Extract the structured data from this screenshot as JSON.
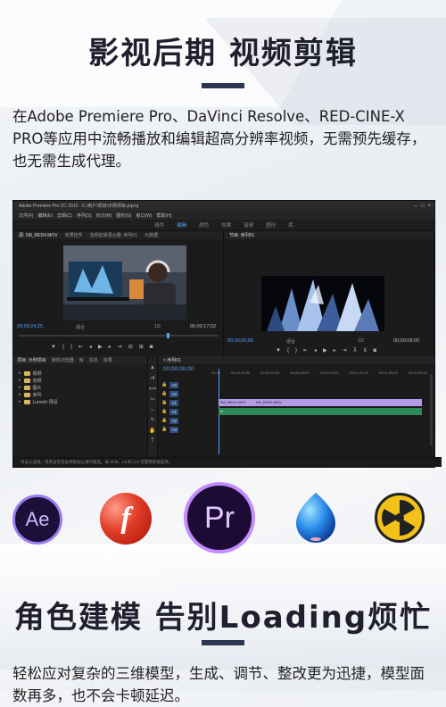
{
  "section1": {
    "title": "影视后期 视频剪辑",
    "description": "在Adobe Premiere Pro、DaVinci Resolve、RED-CINE-X PRO等应用中流畅播放和编辑超高分辨率视频，无需预先缓存，也无需生成代理。"
  },
  "app": {
    "window_title": "Adobe Premiere Pro CC 2015 - C:\\用户\\项目\\示例项目.prproj",
    "menu": [
      "文件(F)",
      "编辑(E)",
      "剪辑(C)",
      "序列(S)",
      "标记(M)",
      "图形(G)",
      "窗口(W)",
      "帮助(H)"
    ],
    "workspaces": [
      "组件",
      "编辑",
      "颜色",
      "效果",
      "音频",
      "图形",
      "库"
    ],
    "active_workspace": "编辑",
    "source_monitor": {
      "tabs": [
        "源: 0I8_RED4.MOV",
        "效果控件",
        "音频剪辑混合器: 序列01",
        "元数据"
      ],
      "timecode_in": "00;00;24;25",
      "fit": "适合",
      "ratio": "1/2",
      "timecode_out": "00;00;17;02"
    },
    "program_monitor": {
      "tabs": [
        "节目: 序列01"
      ],
      "timecode_in": "00;00;00;00",
      "fit": "适合",
      "ratio": "1/2",
      "timecode_out": "00;00;08;00"
    },
    "project_panel": {
      "tabs": [
        "项目: 示例项目",
        "媒体浏览器",
        "库",
        "信息",
        "效果"
      ],
      "items": [
        "视频",
        "音频",
        "图片",
        "序列",
        "Lumetri 预设"
      ]
    },
    "timeline": {
      "tab": "× 序列01",
      "timecode": "00;00;00;00",
      "ruler": [
        "00;00",
        "00;00;16;00",
        "00;00;32;00",
        "00;00;48;00",
        "00;01;04;02",
        "00;01;20;02",
        "00;01;36;02",
        "00;01;52;02"
      ],
      "video_tracks": [
        "V3",
        "V2",
        "V1"
      ],
      "audio_tracks": [
        "A1",
        "A2",
        "A3"
      ],
      "clip_v1_a": "0I8_RED4.MOV",
      "clip_v1_b": "0I8_RED5.MOV"
    },
    "status": "单击以选择，或单击空白处并拖动以进行框选。按 Shift、Alt 和 Ctrl 可使用其他选项。"
  },
  "icons": [
    "after-effects-icon",
    "flash-icon",
    "premiere-pro-icon",
    "droplet-icon",
    "nuke-icon"
  ],
  "section2": {
    "title": "角色建模 告别Loading烦忙",
    "description": "轻松应对复杂的三维模型，生成、调节、整改更为迅捷，模型面数再多，也不会卡顿延迟。"
  }
}
